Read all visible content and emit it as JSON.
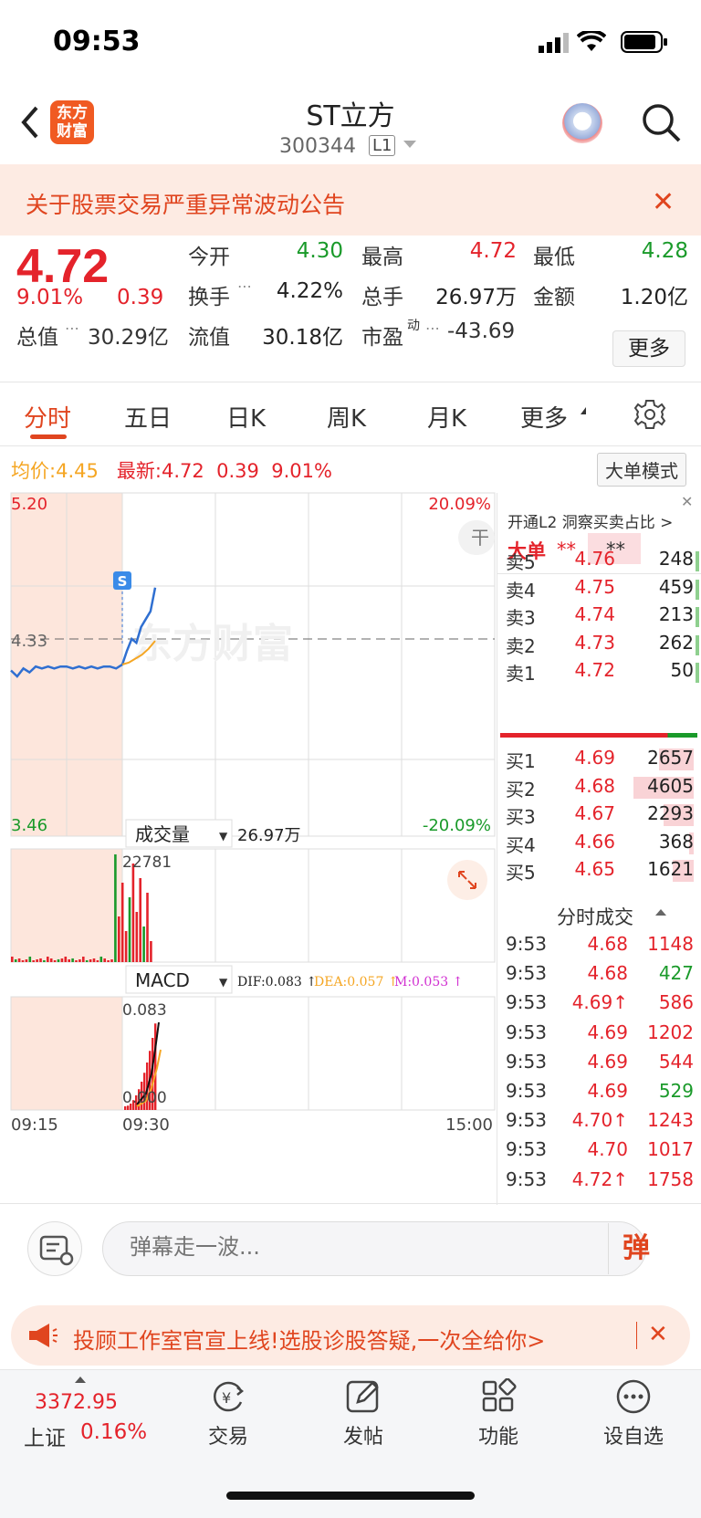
{
  "status": {
    "time": "09:53"
  },
  "header": {
    "title": "ST立方",
    "code": "300344",
    "level": "L1",
    "logo_line1": "东方",
    "logo_line2": "财富"
  },
  "notice": {
    "text": "关于股票交易严重异常波动公告",
    "close": "✕"
  },
  "quote": {
    "price": "4.72",
    "change_pct": "9.01%",
    "change": "0.39",
    "open_label": "今开",
    "open": "4.30",
    "high_label": "最高",
    "high": "4.72",
    "low_label": "最低",
    "low": "4.28",
    "turnover_label": "换手",
    "turnover": "4.22%",
    "volume_label": "总手",
    "volume": "26.97万",
    "amount_label": "金额",
    "amount": "1.20亿",
    "mktcap_label": "总值",
    "mktcap": "30.29亿",
    "float_label": "流值",
    "float_cap": "30.18亿",
    "pe_label": "市盈",
    "pe_sup": "动",
    "pe": "-43.69",
    "more": "更多"
  },
  "tabs": [
    "分时",
    "五日",
    "日K",
    "周K",
    "月K",
    "更多"
  ],
  "chart_info": {
    "avg_label": "均价:",
    "avg": "4.45",
    "latest_label": "最新:",
    "latest": "4.72",
    "latest_chg": "0.39",
    "latest_pct": "9.01%",
    "bigorder_mode": "大单模式"
  },
  "chart_data": {
    "type": "line",
    "price_max": "5.20",
    "price_min": "3.46",
    "pct_max": "20.09%",
    "pct_min": "-20.09%",
    "prev_close": "4.33",
    "watermark": "东方财富",
    "signal": "S",
    "volume_label": "成交量",
    "volume_total": "26.97万",
    "volume_max": "22781",
    "macd_label": "MACD",
    "dif": "DIF:0.083 ↑",
    "dea": "DEA:0.057 ↑",
    "m": "M:0.053 ↑",
    "macd_max": "0.083",
    "macd_min": "0.000",
    "time_start": "09:15",
    "time_mid": "09:30",
    "time_end": "15:00",
    "price_series": [
      4.3,
      4.27,
      4.31,
      4.29,
      4.32,
      4.31,
      4.32,
      4.31,
      4.32,
      4.32,
      4.31,
      4.32,
      4.31,
      4.32,
      4.31,
      4.32,
      4.32,
      4.31,
      4.33,
      4.4,
      4.46,
      4.44,
      4.52,
      4.56,
      4.6,
      4.72
    ],
    "avg_series": [
      4.33,
      4.34,
      4.36,
      4.38,
      4.41,
      4.45
    ]
  },
  "l2": {
    "title": "开通L2 洞察买卖占比 >",
    "big_label": "大单",
    "big_val": "**",
    "big_val2": "**"
  },
  "asks": [
    {
      "label": "卖5",
      "price": "4.76",
      "vol": "248"
    },
    {
      "label": "卖4",
      "price": "4.75",
      "vol": "459"
    },
    {
      "label": "卖3",
      "price": "4.74",
      "vol": "213"
    },
    {
      "label": "卖2",
      "price": "4.73",
      "vol": "262"
    },
    {
      "label": "卖1",
      "price": "4.72",
      "vol": "50"
    }
  ],
  "bids": [
    {
      "label": "买1",
      "price": "4.69",
      "vol": "2657"
    },
    {
      "label": "买2",
      "price": "4.68",
      "vol": "4605"
    },
    {
      "label": "买3",
      "price": "4.67",
      "vol": "2293"
    },
    {
      "label": "买4",
      "price": "4.66",
      "vol": "368"
    },
    {
      "label": "买5",
      "price": "4.65",
      "vol": "1621"
    }
  ],
  "trades_title": "分时成交",
  "trades": [
    {
      "t": "9:53",
      "p": "4.68",
      "v": "1148",
      "c": "red"
    },
    {
      "t": "9:53",
      "p": "4.68",
      "v": "427",
      "c": "green"
    },
    {
      "t": "9:53",
      "p": "4.69↑",
      "v": "586",
      "c": "red"
    },
    {
      "t": "9:53",
      "p": "4.69",
      "v": "1202",
      "c": "red"
    },
    {
      "t": "9:53",
      "p": "4.69",
      "v": "544",
      "c": "red"
    },
    {
      "t": "9:53",
      "p": "4.69",
      "v": "529",
      "c": "green"
    },
    {
      "t": "9:53",
      "p": "4.70↑",
      "v": "1243",
      "c": "red"
    },
    {
      "t": "9:53",
      "p": "4.70",
      "v": "1017",
      "c": "red"
    },
    {
      "t": "9:53",
      "p": "4.72↑",
      "v": "1758",
      "c": "red"
    }
  ],
  "danmu": {
    "placeholder": "弹幕走一波...",
    "btn": "弹"
  },
  "promo": {
    "text": "投顾工作室官宣上线!选股诊股答疑,一次全给你>",
    "close": "✕"
  },
  "tabbar": {
    "index_value": "3372.95",
    "index_name": "上证",
    "index_pct": "0.16%",
    "items": [
      "交易",
      "发帖",
      "功能",
      "设自选"
    ]
  },
  "colors": {
    "red": "#e4232b",
    "green": "#1a9a2a",
    "orange": "#f5a623",
    "blue": "#2f6fd1",
    "accent": "#e0451f"
  }
}
